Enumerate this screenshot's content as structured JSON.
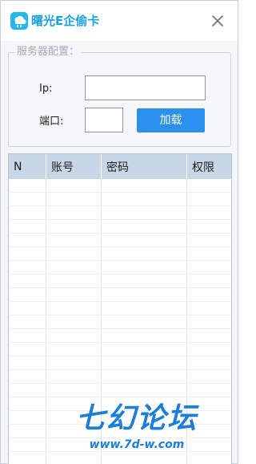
{
  "window": {
    "title": "曙光E企偷卡",
    "app_icon": "cloud-icon",
    "close_icon": "close-icon"
  },
  "server_config": {
    "legend": "服务器配置：",
    "ip_label": "Ip:",
    "ip_value": "",
    "port_label": "端口:",
    "port_value": "",
    "load_button": "加载"
  },
  "table": {
    "columns": [
      "N",
      "账号",
      "密码",
      "权限"
    ],
    "rows": []
  },
  "watermark": {
    "title": "七幻论坛",
    "url": "www.7d-w.com"
  },
  "colors": {
    "accent": "#2b90ee",
    "title_text": "#1aa2de",
    "header_bg": "#c8d7e5",
    "watermark": "#1c7ed6"
  }
}
